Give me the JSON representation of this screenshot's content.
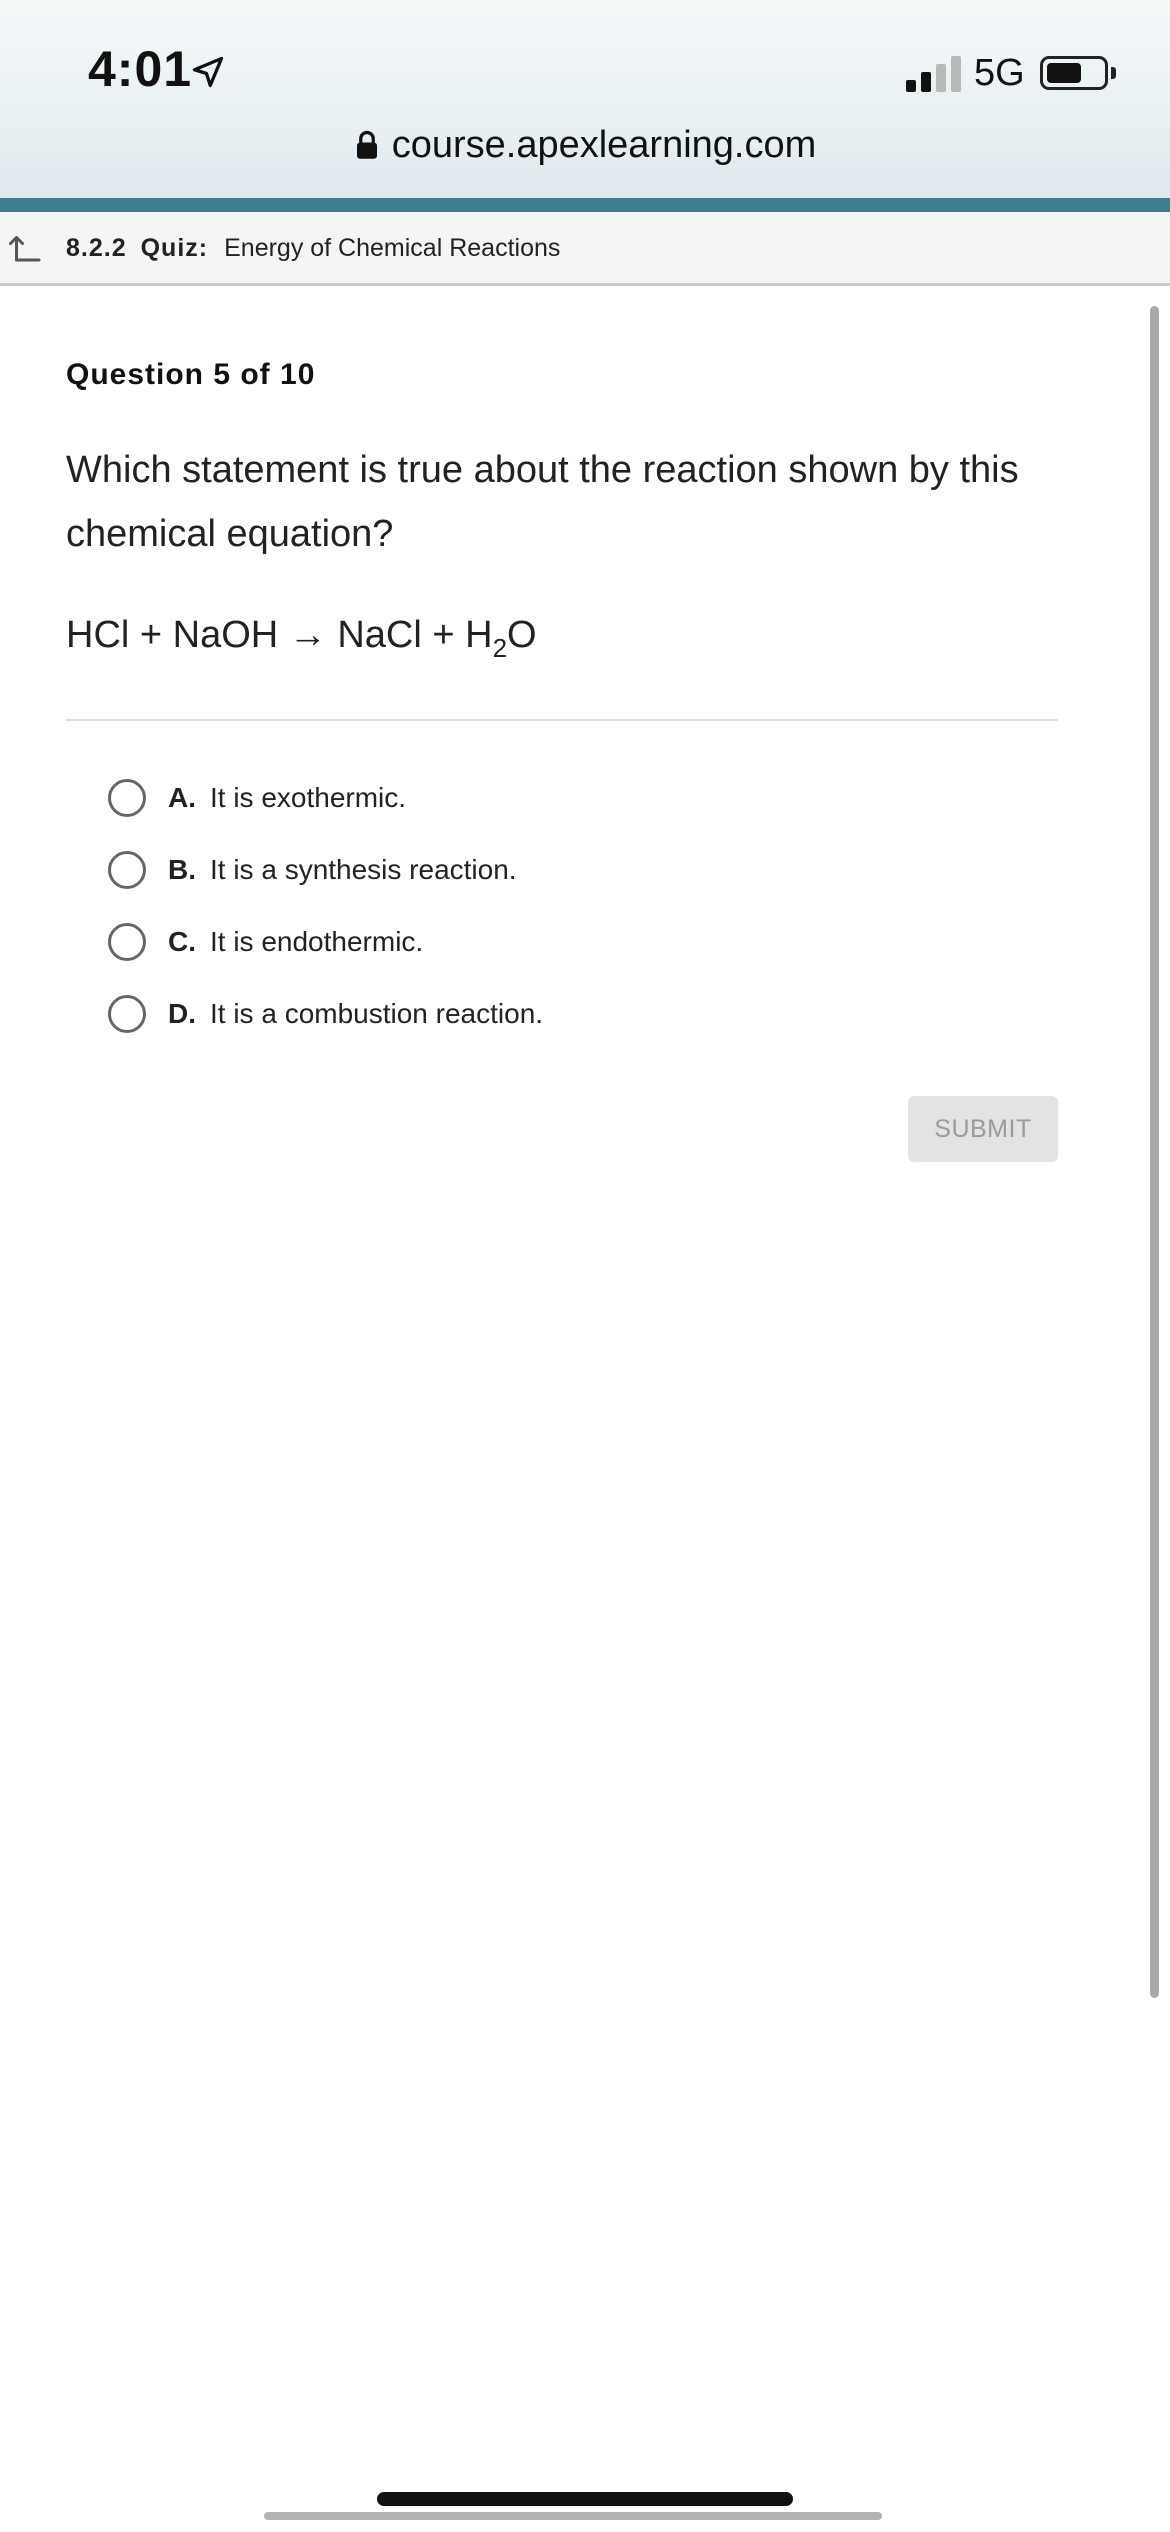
{
  "status_bar": {
    "time": "4:01",
    "network": "5G",
    "icons": [
      "location-arrow-icon",
      "signal-bars-icon",
      "battery-icon"
    ]
  },
  "browser": {
    "url": "course.apexlearning.com",
    "lock_icon": "lock-icon"
  },
  "breadcrumb": {
    "section": "8.2.2",
    "kind": "Quiz:",
    "title": "Energy of Chemical Reactions",
    "back_icon": "return-arrow-icon"
  },
  "question": {
    "counter": "Question 5 of 10",
    "prompt": "Which statement is true about the reaction shown by this chemical equation?",
    "equation": {
      "lhs": "HCl + NaOH",
      "arrow": "→",
      "rhs_before_sub": "NaCl + H",
      "subscript": "2",
      "rhs_after_sub": "O"
    }
  },
  "options": [
    {
      "letter": "A.",
      "text": "It is exothermic."
    },
    {
      "letter": "B.",
      "text": "It is a synthesis reaction."
    },
    {
      "letter": "C.",
      "text": "It is endothermic."
    },
    {
      "letter": "D.",
      "text": "It is a combustion reaction."
    }
  ],
  "submit": {
    "label": "SUBMIT",
    "enabled": false
  },
  "colors": {
    "accent_stripe": "#3f7d8e",
    "submit_bg": "#e3e3e3",
    "submit_text": "#9a9a9a"
  }
}
